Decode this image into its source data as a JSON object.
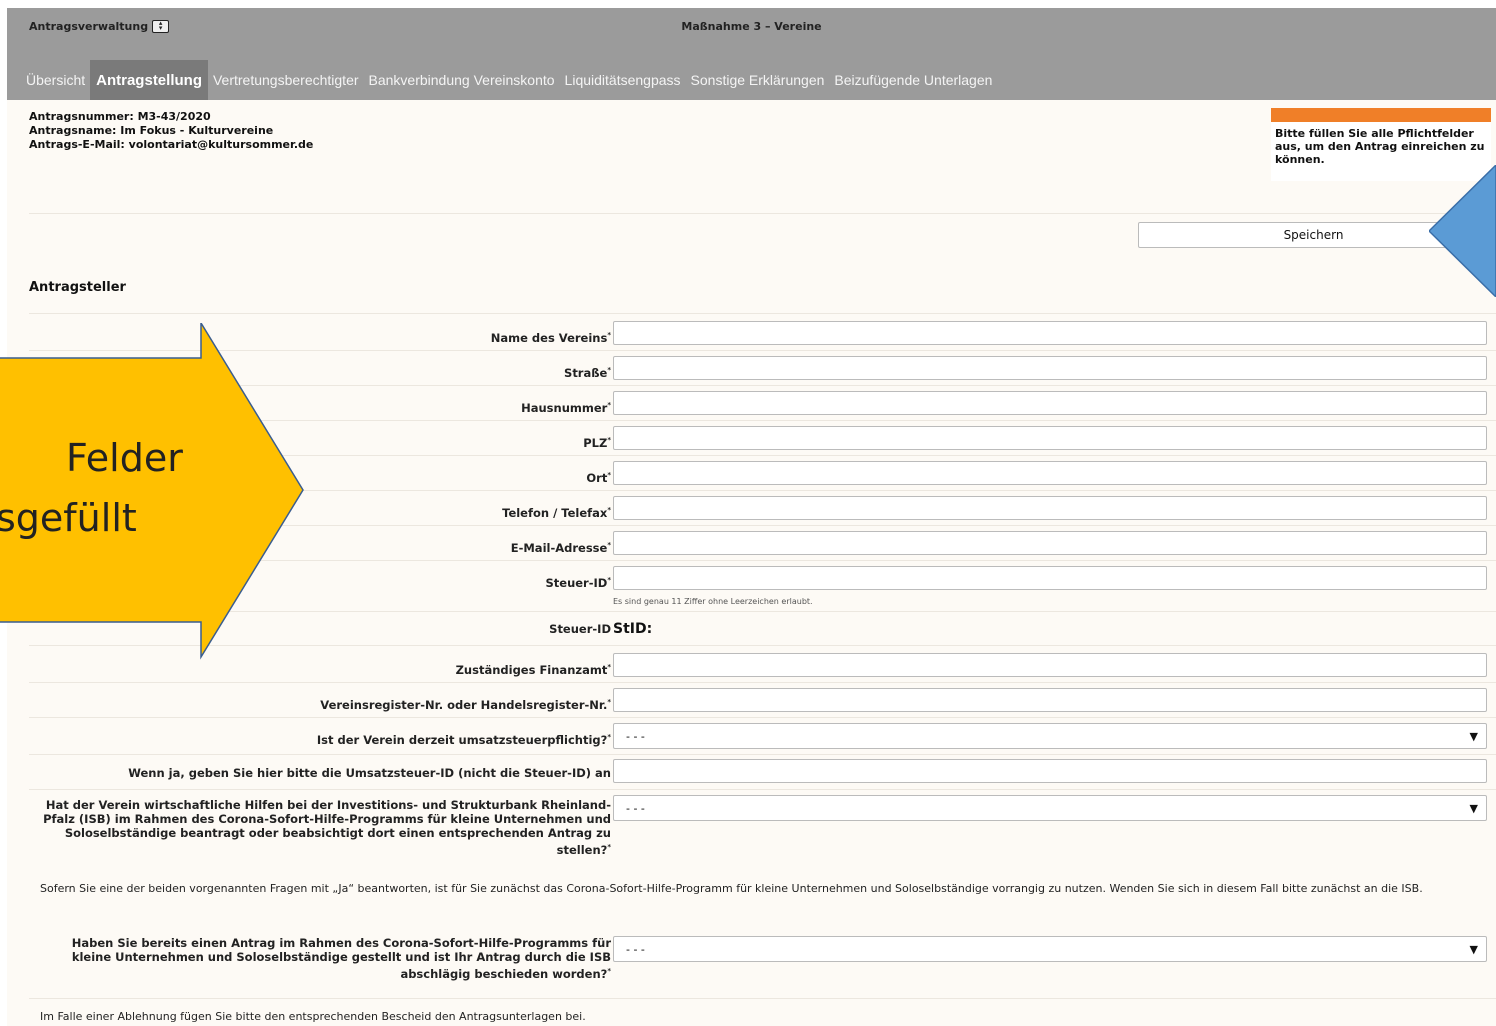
{
  "header": {
    "app_title": "Antragsverwaltung",
    "page_title": "Maßnahme 3 – Vereine"
  },
  "nav": {
    "tabs": [
      "Übersicht",
      "Antragstellung",
      "Vertretungsberechtigter",
      "Bankverbindung Vereinskonto",
      "Liquiditätsengpass",
      "Sonstige Erklärungen",
      "Beizufügende Unterlagen"
    ],
    "active": "Antragstellung"
  },
  "meta": {
    "number": "Antragsnummer: M3-43/2020",
    "name": "Antragsname: Im Fokus - Kulturvereine",
    "email": "Antrags-E-Mail: volontariat@kultursommer.de"
  },
  "notice": {
    "text": "Bitte füllen Sie alle Pflichtfelder aus, um den Antrag einreichen zu können.",
    "color": "#f07f28"
  },
  "save_label": "Speichern",
  "section_title": "Antragsteller",
  "fields": {
    "name": "Name des Vereins",
    "strasse": "Straße",
    "hausnummer": "Hausnummer",
    "plz": "PLZ",
    "ort": "Ort",
    "telefon": "Telefon / Telefax",
    "email": "E-Mail-Adresse",
    "steuerid": "Steuer-ID",
    "steuerid_hint": "Es sind genau 11 Ziffer ohne Leerzeichen erlaubt.",
    "steuerid_static": "Steuer-ID",
    "steuerid_value": "StID:",
    "finanzamt": "Zuständiges Finanzamt",
    "register": "Vereinsregister-Nr. oder Handelsregister-Nr.",
    "umsatzsteuer": "Ist der Verein derzeit umsatzsteuerpflichtig?",
    "umsatzsteuer_value": "- - -",
    "ustid": "Wenn ja, geben Sie hier bitte die Umsatzsteuer-ID (nicht die Steuer-ID) an",
    "isb_hilfen": "Hat der Verein wirtschaftliche Hilfen bei der Investitions- und Strukturbank Rheinland-Pfalz (ISB) im Rahmen des Corona-Sofort-Hilfe-Programms für kleine Unternehmen und Soloselbständige beantragt oder beabsichtigt dort einen entsprechenden Antrag zu stellen?",
    "isb_hilfen_value": "- - -",
    "info_text": "Sofern Sie eine der beiden vorgenannten Fragen mit „Ja“ beantworten, ist für Sie zunächst das Corona-Sofort-Hilfe-Programm für kleine Unternehmen und Soloselbständige vorrangig zu nutzen. Wenden Sie sich in diesem Fall bitte zunächst an die ISB.",
    "antrag_gestellt": "Haben Sie bereits einen Antrag im Rahmen des Corona-Sofort-Hilfe-Programms für kleine Unternehmen und Soloselbständige gestellt und ist Ihr Antrag durch die ISB abschlägig beschieden worden?",
    "antrag_gestellt_value": "- - -",
    "ablehnung_text": "Im Falle einer Ablehnung fügen Sie bitte den entsprechenden Bescheid den Antragsunterlagen bei.",
    "required_mark": "*"
  },
  "annotation": {
    "line1": "Felder",
    "line2": "sgefüllt",
    "arrow_color": "#ffc000",
    "blue_color": "#5b9bd5"
  }
}
